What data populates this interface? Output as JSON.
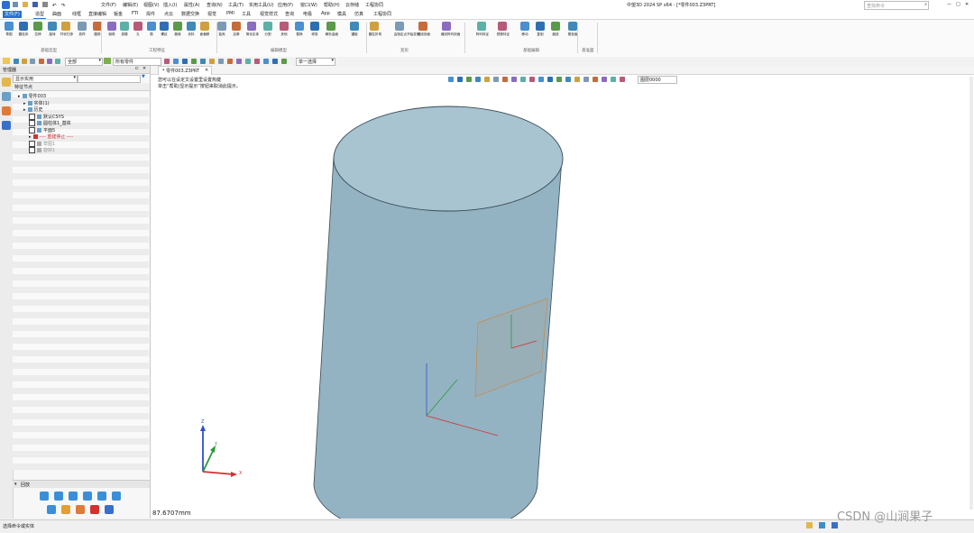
{
  "app": {
    "title": "中望3D 2024 SP x64 - [*零件003.Z3PRT]",
    "search_placeholder": "查找命令"
  },
  "menu": [
    "文件(F)",
    "编辑(E)",
    "视图(V)",
    "插入(I)",
    "属性(A)",
    "查询(N)",
    "工具(T)",
    "实用工具(U)",
    "应用(P)",
    "窗口(W)",
    "帮助(H)",
    "云存储",
    "工程协同"
  ],
  "tabs": [
    "文件(F)",
    "造型",
    "曲面",
    "线框",
    "直接编辑",
    "钣金",
    "FTI",
    "焊件",
    "点云",
    "数据交换",
    "视觉",
    "PMI",
    "工具",
    "视觉样式",
    "查询",
    "电极",
    "App",
    "模具",
    "仿真",
    "工程协同"
  ],
  "ribbon": {
    "groups": [
      "基础造型",
      "工程特征",
      "编辑模型",
      "变形",
      "基础编辑",
      "基准面"
    ],
    "buttons": [
      "草图",
      "圆柱体",
      "拉伸",
      "旋转",
      "杆状扫掠",
      "放样",
      "圆角",
      "倒角",
      "拔模",
      "孔",
      "筋",
      "螺纹",
      "唇缘",
      "坯料",
      "面偏移",
      "抽壳",
      "加厚",
      "简化实体",
      "分割",
      "其他",
      "替换",
      "修剪",
      "解析曲面",
      "镶嵌",
      "圆柱折弯",
      "由指定点开始变形",
      "缠绕到面",
      "缠绕阵列到面",
      "阵列特征",
      "镜像特征",
      "移动",
      "复制",
      "缩放",
      "基准面"
    ]
  },
  "toolbar": {
    "filter_label": "全部",
    "part_filter": "所有零件",
    "pick_mode": "单一选择",
    "layer": "图层0000"
  },
  "manager": {
    "title": "管理器",
    "display_mode": "显示实用",
    "section": "特征节点",
    "tree": [
      {
        "label": "零件003",
        "indent": 0,
        "icon": "part-icon",
        "check": false
      },
      {
        "label": "实体(1)",
        "indent": 1,
        "icon": "solid-icon",
        "check": false
      },
      {
        "label": "历史",
        "indent": 1,
        "icon": "history-icon",
        "check": false
      },
      {
        "label": "默认CSYS",
        "indent": 2,
        "icon": "csys-icon",
        "check": true
      },
      {
        "label": "圆柱体1_基体",
        "indent": 2,
        "icon": "cylinder-icon",
        "check": true
      },
      {
        "label": "平面5",
        "indent": 2,
        "icon": "plane-icon",
        "check": true
      },
      {
        "label": "---- 重建停止 ----",
        "indent": 2,
        "icon": "stop-icon",
        "check": false,
        "red": true
      },
      {
        "label": "草图1",
        "indent": 2,
        "icon": "sketch-icon",
        "check": true,
        "gray": true
      },
      {
        "label": "旋转1",
        "indent": 2,
        "icon": "revolve-icon",
        "check": true,
        "gray": true
      }
    ],
    "playback_label": "回放"
  },
  "viewport": {
    "tab_title": "* 零件003.Z3PRT",
    "hint_line1": "您可以在设定文设置里设置热键",
    "hint_line2": "单击“帮助/显示提示”按钮来取消此提示。",
    "measure": "87.6707mm",
    "axes": {
      "x": "X",
      "y": "Y",
      "z": "Z"
    }
  },
  "status": {
    "text": "选择命令或实体",
    "watermark": "CSDN @山涧果子"
  },
  "colors": {
    "accent": "#2a6fcf",
    "cylinder_side": "#93b3c2",
    "cylinder_top": "#a7c4d0",
    "axis_x": "#d43030",
    "axis_y": "#2a9a3a",
    "axis_z": "#3050c8"
  }
}
